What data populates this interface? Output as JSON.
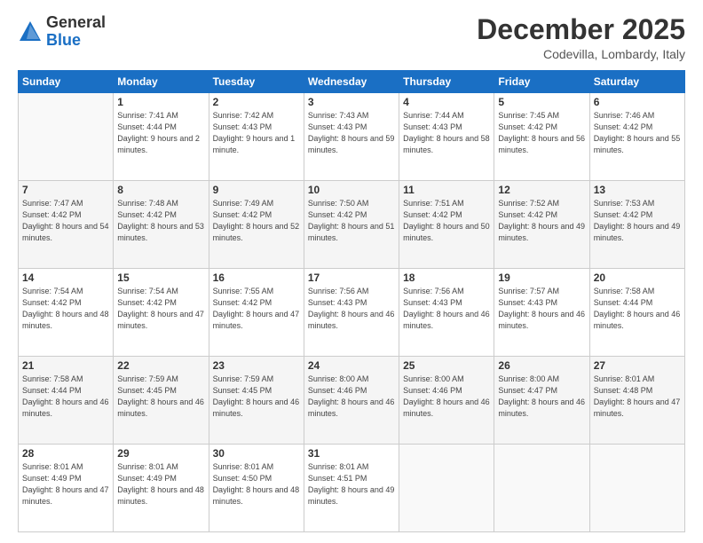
{
  "header": {
    "logo_general": "General",
    "logo_blue": "Blue",
    "month_title": "December 2025",
    "location": "Codevilla, Lombardy, Italy"
  },
  "days_of_week": [
    "Sunday",
    "Monday",
    "Tuesday",
    "Wednesday",
    "Thursday",
    "Friday",
    "Saturday"
  ],
  "weeks": [
    [
      {
        "day": "",
        "sunrise": "",
        "sunset": "",
        "daylight": ""
      },
      {
        "day": "1",
        "sunrise": "Sunrise: 7:41 AM",
        "sunset": "Sunset: 4:44 PM",
        "daylight": "Daylight: 9 hours and 2 minutes."
      },
      {
        "day": "2",
        "sunrise": "Sunrise: 7:42 AM",
        "sunset": "Sunset: 4:43 PM",
        "daylight": "Daylight: 9 hours and 1 minute."
      },
      {
        "day": "3",
        "sunrise": "Sunrise: 7:43 AM",
        "sunset": "Sunset: 4:43 PM",
        "daylight": "Daylight: 8 hours and 59 minutes."
      },
      {
        "day": "4",
        "sunrise": "Sunrise: 7:44 AM",
        "sunset": "Sunset: 4:43 PM",
        "daylight": "Daylight: 8 hours and 58 minutes."
      },
      {
        "day": "5",
        "sunrise": "Sunrise: 7:45 AM",
        "sunset": "Sunset: 4:42 PM",
        "daylight": "Daylight: 8 hours and 56 minutes."
      },
      {
        "day": "6",
        "sunrise": "Sunrise: 7:46 AM",
        "sunset": "Sunset: 4:42 PM",
        "daylight": "Daylight: 8 hours and 55 minutes."
      }
    ],
    [
      {
        "day": "7",
        "sunrise": "Sunrise: 7:47 AM",
        "sunset": "Sunset: 4:42 PM",
        "daylight": "Daylight: 8 hours and 54 minutes."
      },
      {
        "day": "8",
        "sunrise": "Sunrise: 7:48 AM",
        "sunset": "Sunset: 4:42 PM",
        "daylight": "Daylight: 8 hours and 53 minutes."
      },
      {
        "day": "9",
        "sunrise": "Sunrise: 7:49 AM",
        "sunset": "Sunset: 4:42 PM",
        "daylight": "Daylight: 8 hours and 52 minutes."
      },
      {
        "day": "10",
        "sunrise": "Sunrise: 7:50 AM",
        "sunset": "Sunset: 4:42 PM",
        "daylight": "Daylight: 8 hours and 51 minutes."
      },
      {
        "day": "11",
        "sunrise": "Sunrise: 7:51 AM",
        "sunset": "Sunset: 4:42 PM",
        "daylight": "Daylight: 8 hours and 50 minutes."
      },
      {
        "day": "12",
        "sunrise": "Sunrise: 7:52 AM",
        "sunset": "Sunset: 4:42 PM",
        "daylight": "Daylight: 8 hours and 49 minutes."
      },
      {
        "day": "13",
        "sunrise": "Sunrise: 7:53 AM",
        "sunset": "Sunset: 4:42 PM",
        "daylight": "Daylight: 8 hours and 49 minutes."
      }
    ],
    [
      {
        "day": "14",
        "sunrise": "Sunrise: 7:54 AM",
        "sunset": "Sunset: 4:42 PM",
        "daylight": "Daylight: 8 hours and 48 minutes."
      },
      {
        "day": "15",
        "sunrise": "Sunrise: 7:54 AM",
        "sunset": "Sunset: 4:42 PM",
        "daylight": "Daylight: 8 hours and 47 minutes."
      },
      {
        "day": "16",
        "sunrise": "Sunrise: 7:55 AM",
        "sunset": "Sunset: 4:42 PM",
        "daylight": "Daylight: 8 hours and 47 minutes."
      },
      {
        "day": "17",
        "sunrise": "Sunrise: 7:56 AM",
        "sunset": "Sunset: 4:43 PM",
        "daylight": "Daylight: 8 hours and 46 minutes."
      },
      {
        "day": "18",
        "sunrise": "Sunrise: 7:56 AM",
        "sunset": "Sunset: 4:43 PM",
        "daylight": "Daylight: 8 hours and 46 minutes."
      },
      {
        "day": "19",
        "sunrise": "Sunrise: 7:57 AM",
        "sunset": "Sunset: 4:43 PM",
        "daylight": "Daylight: 8 hours and 46 minutes."
      },
      {
        "day": "20",
        "sunrise": "Sunrise: 7:58 AM",
        "sunset": "Sunset: 4:44 PM",
        "daylight": "Daylight: 8 hours and 46 minutes."
      }
    ],
    [
      {
        "day": "21",
        "sunrise": "Sunrise: 7:58 AM",
        "sunset": "Sunset: 4:44 PM",
        "daylight": "Daylight: 8 hours and 46 minutes."
      },
      {
        "day": "22",
        "sunrise": "Sunrise: 7:59 AM",
        "sunset": "Sunset: 4:45 PM",
        "daylight": "Daylight: 8 hours and 46 minutes."
      },
      {
        "day": "23",
        "sunrise": "Sunrise: 7:59 AM",
        "sunset": "Sunset: 4:45 PM",
        "daylight": "Daylight: 8 hours and 46 minutes."
      },
      {
        "day": "24",
        "sunrise": "Sunrise: 8:00 AM",
        "sunset": "Sunset: 4:46 PM",
        "daylight": "Daylight: 8 hours and 46 minutes."
      },
      {
        "day": "25",
        "sunrise": "Sunrise: 8:00 AM",
        "sunset": "Sunset: 4:46 PM",
        "daylight": "Daylight: 8 hours and 46 minutes."
      },
      {
        "day": "26",
        "sunrise": "Sunrise: 8:00 AM",
        "sunset": "Sunset: 4:47 PM",
        "daylight": "Daylight: 8 hours and 46 minutes."
      },
      {
        "day": "27",
        "sunrise": "Sunrise: 8:01 AM",
        "sunset": "Sunset: 4:48 PM",
        "daylight": "Daylight: 8 hours and 47 minutes."
      }
    ],
    [
      {
        "day": "28",
        "sunrise": "Sunrise: 8:01 AM",
        "sunset": "Sunset: 4:49 PM",
        "daylight": "Daylight: 8 hours and 47 minutes."
      },
      {
        "day": "29",
        "sunrise": "Sunrise: 8:01 AM",
        "sunset": "Sunset: 4:49 PM",
        "daylight": "Daylight: 8 hours and 48 minutes."
      },
      {
        "day": "30",
        "sunrise": "Sunrise: 8:01 AM",
        "sunset": "Sunset: 4:50 PM",
        "daylight": "Daylight: 8 hours and 48 minutes."
      },
      {
        "day": "31",
        "sunrise": "Sunrise: 8:01 AM",
        "sunset": "Sunset: 4:51 PM",
        "daylight": "Daylight: 8 hours and 49 minutes."
      },
      {
        "day": "",
        "sunrise": "",
        "sunset": "",
        "daylight": ""
      },
      {
        "day": "",
        "sunrise": "",
        "sunset": "",
        "daylight": ""
      },
      {
        "day": "",
        "sunrise": "",
        "sunset": "",
        "daylight": ""
      }
    ]
  ]
}
